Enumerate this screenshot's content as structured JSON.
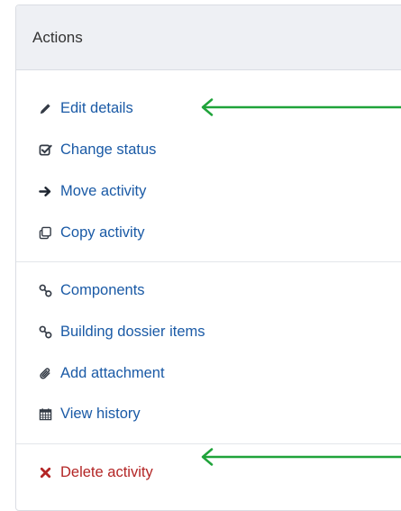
{
  "panel": {
    "title": "Actions"
  },
  "actions": {
    "edit_details": "Edit details",
    "change_status": "Change status",
    "move_activity": "Move activity",
    "copy_activity": "Copy activity",
    "components": "Components",
    "building_dossier_items": "Building dossier items",
    "add_attachment": "Add attachment",
    "view_history": "View history",
    "delete_activity": "Delete activity"
  },
  "icons": {
    "edit_details": "pencil-icon",
    "change_status": "checked-square-icon",
    "move_activity": "arrow-right-icon",
    "copy_activity": "copy-icon",
    "components": "link-icon",
    "building_dossier_items": "link-icon",
    "add_attachment": "paperclip-icon",
    "view_history": "calendar-icon",
    "delete_activity": "x-icon"
  },
  "colors": {
    "link": "#1a5aa6",
    "danger": "#b32525",
    "header_bg": "#eef0f4",
    "annotation_arrow": "#1fa33a"
  }
}
